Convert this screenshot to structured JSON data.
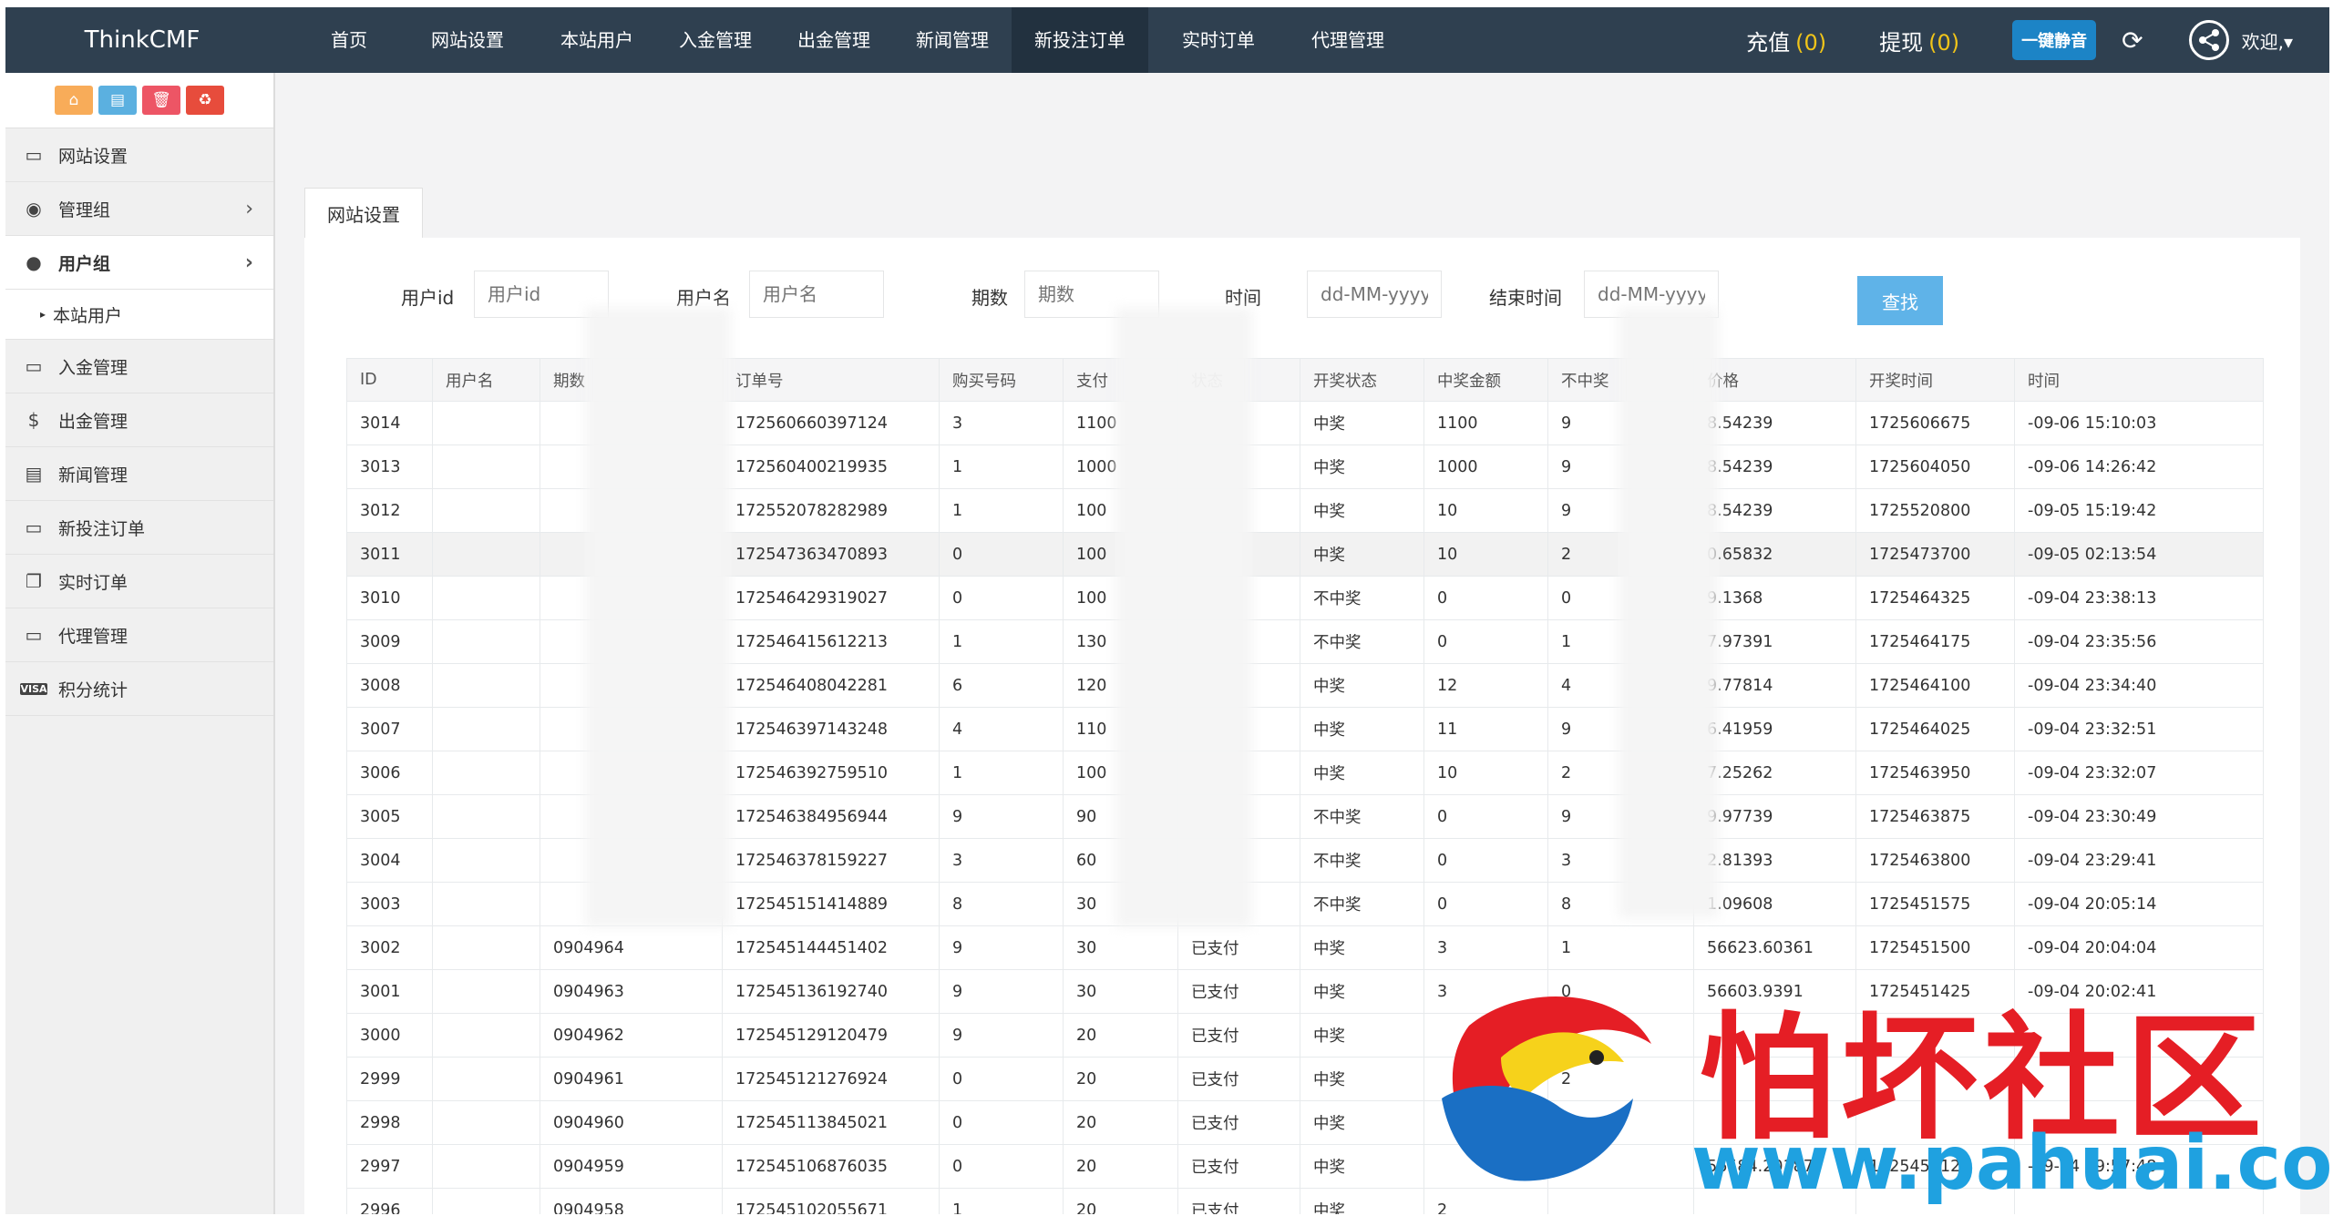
{
  "app": {
    "brand": "ThinkCMF"
  },
  "nav": [
    {
      "label": "首页"
    },
    {
      "label": "网站设置"
    },
    {
      "label": "本站用户"
    },
    {
      "label": "入金管理"
    },
    {
      "label": "出金管理"
    },
    {
      "label": "新闻管理"
    },
    {
      "label": "新投注订单"
    },
    {
      "label": "实时订单"
    },
    {
      "label": "代理管理"
    }
  ],
  "header": {
    "recharge_label": "充值",
    "recharge_count": "(0)",
    "withdraw_label": "提现",
    "withdraw_count": "(0)",
    "mute_label": "一键静音",
    "welcome": "欢迎,▾"
  },
  "shortcuts": [
    {
      "icon": "home-icon",
      "glyph": "⌂"
    },
    {
      "icon": "file-icon",
      "glyph": "▤"
    },
    {
      "icon": "trash-icon",
      "glyph": "🗑"
    },
    {
      "icon": "recycle-icon",
      "glyph": "♻"
    }
  ],
  "sidebar": {
    "items": [
      {
        "label": "网站设置",
        "icon": "monitor-icon"
      },
      {
        "label": "管理组",
        "icon": "user-circle-icon"
      },
      {
        "label": "用户组",
        "icon": "user-icon"
      },
      {
        "label": "本站用户"
      },
      {
        "label": "入金管理",
        "icon": "monitor-icon"
      },
      {
        "label": "出金管理",
        "icon": "dollar-icon"
      },
      {
        "label": "新闻管理",
        "icon": "news-icon"
      },
      {
        "label": "新投注订单",
        "icon": "monitor-icon"
      },
      {
        "label": "实时订单",
        "icon": "windows-icon"
      },
      {
        "label": "代理管理",
        "icon": "monitor-icon"
      },
      {
        "label": "积分统计",
        "icon": "visa-icon"
      }
    ]
  },
  "tab": {
    "label": "网站设置"
  },
  "filters": {
    "userid_label": "用户id",
    "userid_placeholder": "用户id",
    "username_label": "用户名",
    "username_placeholder": "用户名",
    "period_label": "期数",
    "period_placeholder": "期数",
    "start_label": "时间",
    "start_placeholder": "dd-MM-yyyy",
    "end_label": "结束时间",
    "end_placeholder": "dd-MM-yyyy",
    "search_label": "查找"
  },
  "table": {
    "headers": [
      "ID",
      "用户名",
      "期数",
      "订单号",
      "购买号码",
      "支付",
      "状态",
      "开奖状态",
      "中奖金额",
      "不中奖",
      "价格",
      "开奖时间",
      "时间"
    ],
    "rows": [
      [
        "3014",
        "",
        "",
        "172560660397124",
        "3",
        "1100",
        "",
        "中奖",
        "1100",
        "9",
        "8.54239",
        "1725606675",
        "-09-06 15:10:03"
      ],
      [
        "3013",
        "",
        "",
        "172560400219935",
        "1",
        "1000",
        "",
        "中奖",
        "1000",
        "9",
        "8.54239",
        "1725604050",
        "-09-06 14:26:42"
      ],
      [
        "3012",
        "",
        "",
        "172552078282989",
        "1",
        "100",
        "",
        "中奖",
        "10",
        "9",
        "8.54239",
        "1725520800",
        "-09-05 15:19:42"
      ],
      [
        "3011",
        "",
        "",
        "172547363470893",
        "0",
        "100",
        "",
        "中奖",
        "10",
        "2",
        "0.65832",
        "1725473700",
        "-09-05 02:13:54"
      ],
      [
        "3010",
        "",
        "",
        "172546429319027",
        "0",
        "100",
        "",
        "不中奖",
        "0",
        "0",
        "9.1368",
        "1725464325",
        "-09-04 23:38:13"
      ],
      [
        "3009",
        "",
        "",
        "172546415612213",
        "1",
        "130",
        "",
        "不中奖",
        "0",
        "1",
        "7.97391",
        "1725464175",
        "-09-04 23:35:56"
      ],
      [
        "3008",
        "",
        "",
        "172546408042281",
        "6",
        "120",
        "",
        "中奖",
        "12",
        "4",
        "9.77814",
        "1725464100",
        "-09-04 23:34:40"
      ],
      [
        "3007",
        "",
        "",
        "172546397143248",
        "4",
        "110",
        "",
        "中奖",
        "11",
        "9",
        "6.41959",
        "1725464025",
        "-09-04 23:32:51"
      ],
      [
        "3006",
        "",
        "",
        "172546392759510",
        "1",
        "100",
        "",
        "中奖",
        "10",
        "2",
        "7.25262",
        "1725463950",
        "-09-04 23:32:07"
      ],
      [
        "3005",
        "",
        "",
        "172546384956944",
        "9",
        "90",
        "",
        "不中奖",
        "0",
        "9",
        "9.97739",
        "1725463875",
        "-09-04 23:30:49"
      ],
      [
        "3004",
        "",
        "",
        "172546378159227",
        "3",
        "60",
        "",
        "不中奖",
        "0",
        "3",
        "2.81393",
        "1725463800",
        "-09-04 23:29:41"
      ],
      [
        "3003",
        "",
        "",
        "172545151414889",
        "8",
        "30",
        "",
        "不中奖",
        "0",
        "8",
        "1.09608",
        "1725451575",
        "-09-04 20:05:14"
      ],
      [
        "3002",
        "",
        "0904964",
        "172545144451402",
        "9",
        "30",
        "已支付",
        "中奖",
        "3",
        "1",
        "56623.60361",
        "1725451500",
        "-09-04 20:04:04"
      ],
      [
        "3001",
        "",
        "0904963",
        "172545136192740",
        "9",
        "30",
        "已支付",
        "中奖",
        "3",
        "0",
        "56603.9391",
        "1725451425",
        "-09-04 20:02:41"
      ],
      [
        "3000",
        "",
        "0904962",
        "172545129120479",
        "9",
        "20",
        "已支付",
        "中奖",
        "",
        "",
        "",
        "",
        ""
      ],
      [
        "2999",
        "",
        "0904961",
        "172545121276924",
        "0",
        "20",
        "已支付",
        "中奖",
        "",
        "2",
        "",
        "",
        ""
      ],
      [
        "2998",
        "",
        "0904960",
        "172545113845021",
        "0",
        "20",
        "已支付",
        "中奖",
        "",
        "",
        "",
        "",
        ""
      ],
      [
        "2997",
        "",
        "0904959",
        "172545106876035",
        "0",
        "20",
        "已支付",
        "中奖",
        "",
        "",
        "56584.20187",
        "1725451125",
        "-09-04 19:57:48"
      ],
      [
        "2996",
        "",
        "0904958",
        "172545102055671",
        "1",
        "20",
        "已支付",
        "中奖",
        "2",
        "",
        "",
        "",
        ""
      ]
    ]
  },
  "watermark": {
    "name": "怕坏社区",
    "url": "www.pahuai.com"
  },
  "colors": {
    "topbar": "#2f4050",
    "accent": "#1c84c6",
    "search": "#5fb3e8",
    "count": "#f0c419"
  }
}
